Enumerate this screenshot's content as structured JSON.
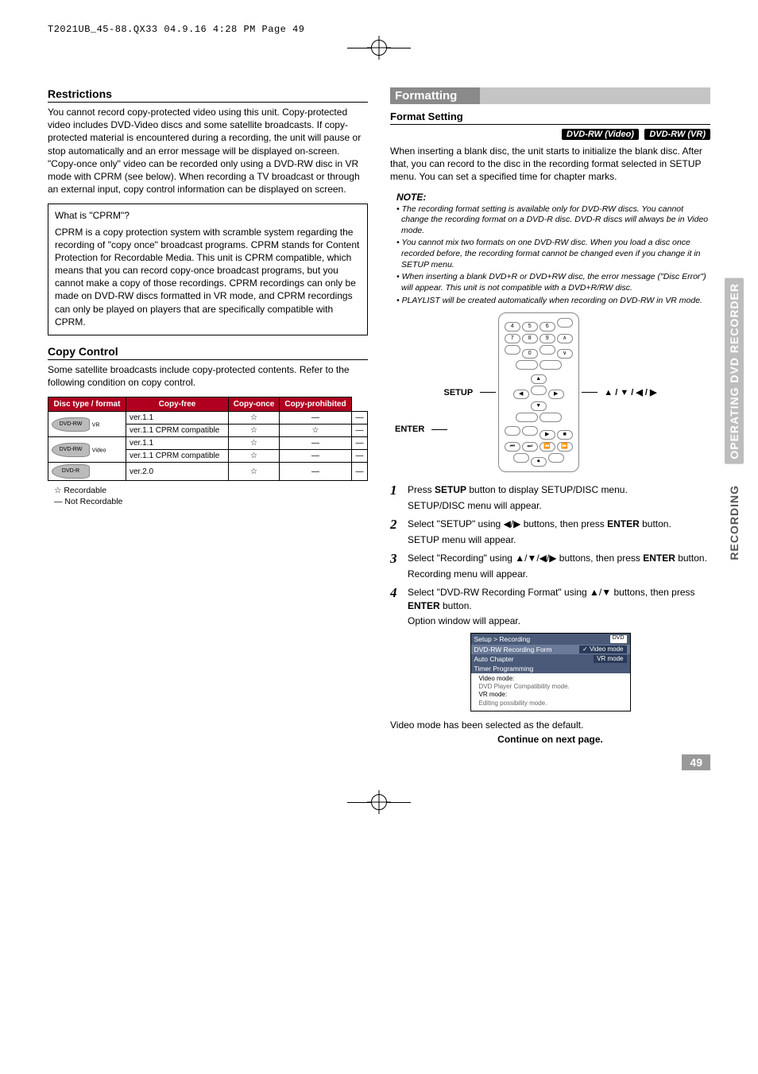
{
  "header": {
    "imprint": "T2021UB_45-88.QX33  04.9.16  4:28 PM  Page 49"
  },
  "side_tabs": {
    "top": "OPERATING DVD RECORDER",
    "bottom": "RECORDING"
  },
  "left": {
    "restrictions": {
      "heading": "Restrictions",
      "body": "You cannot record copy-protected video using this unit. Copy-protected video includes DVD-Video discs and some satellite broadcasts. If copy-protected material is encountered during a recording, the unit will pause or stop automatically and an error message will be displayed on-screen. \"Copy-once only\" video can be recorded only using a DVD-RW disc in VR mode with CPRM (see below). When recording a TV broadcast or through an external input, copy control information can be displayed on screen.",
      "cprm_title": "What is \"CPRM\"?",
      "cprm_body": "CPRM is a copy protection system with scramble system regarding the recording of \"copy once\" broadcast programs. CPRM stands for Content Protection for Recordable Media. This unit is CPRM compatible, which means that you can record copy-once broadcast programs, but you cannot make a copy of those recordings. CPRM recordings can only be made on DVD-RW discs formatted in VR mode, and CPRM recordings can only be played on players that are specifically compatible with CPRM."
    },
    "copy_control": {
      "heading": "Copy Control",
      "body": "Some satellite broadcasts include copy-protected contents. Refer to the following condition on copy control.",
      "table": {
        "headers": [
          "Disc type / format",
          "Copy-free",
          "Copy-once",
          "Copy-prohibited"
        ],
        "rows": [
          {
            "logo": "DVD-RW",
            "sub": "VR",
            "fmt": "ver.1.1",
            "cf": "☆",
            "co": "—",
            "cp": "—"
          },
          {
            "logo": "DVD-RW",
            "sub": "VR",
            "fmt": "ver.1.1 CPRM compatible",
            "cf": "☆",
            "co": "☆",
            "cp": "—"
          },
          {
            "logo": "DVD-RW",
            "sub": "Video",
            "fmt": "ver.1.1",
            "cf": "☆",
            "co": "—",
            "cp": "—"
          },
          {
            "logo": "DVD-RW",
            "sub": "Video",
            "fmt": "ver.1.1 CPRM compatible",
            "cf": "☆",
            "co": "—",
            "cp": "—"
          },
          {
            "logo": "DVD-R",
            "sub": "",
            "fmt": "ver.2.0",
            "cf": "☆",
            "co": "—",
            "cp": "—"
          }
        ]
      },
      "legend_rec": "☆   Recordable",
      "legend_nr": "—   Not Recordable"
    }
  },
  "right": {
    "formatting": {
      "heading": "Formatting",
      "sub": "Format Setting",
      "badges": [
        "DVD-RW (Video)",
        "DVD-RW (VR)"
      ],
      "body": "When inserting a blank disc, the unit starts to initialize the blank disc. After that, you can record to the disc in the recording format selected in SETUP menu. You can set a specified time for chapter marks.",
      "note_title": "NOTE:",
      "notes": [
        "• The recording format setting is available only for DVD-RW discs. You cannot change the recording format on a DVD-R disc. DVD-R discs will always be in Video mode.",
        "• You cannot mix two formats on one DVD-RW disc. When you load a disc once recorded before, the recording format cannot be changed even if you change it in SETUP menu.",
        "• When inserting a blank DVD+R or DVD+RW disc, the error message (\"Disc Error\") will appear. This unit is not compatible with a DVD+R/RW disc.",
        "• PLAYLIST will be created automatically when recording on DVD-RW in VR mode."
      ],
      "remote_labels": {
        "setup": "SETUP",
        "enter": "ENTER",
        "arrows": "▲ / ▼ / ◀ / ▶"
      },
      "steps": [
        {
          "num": "1",
          "text_a": "Press ",
          "bold_a": "SETUP",
          "text_b": " button to display SETUP/DISC menu.",
          "sub": "SETUP/DISC menu will appear."
        },
        {
          "num": "2",
          "text_a": "Select \"SETUP\" using ◀/▶ buttons, then press ",
          "bold_a": "ENTER",
          "text_b": " button.",
          "sub": "SETUP menu will appear."
        },
        {
          "num": "3",
          "text_a": "Select \"Recording\" using ▲/▼/◀/▶ buttons, then press ",
          "bold_a": "ENTER",
          "text_b": " button.",
          "sub": "Recording menu will appear."
        },
        {
          "num": "4",
          "text_a": "Select \"DVD-RW Recording Format\" using ▲/▼ buttons, then press ",
          "bold_a": "ENTER",
          "text_b": " button.",
          "sub": "Option window will appear."
        }
      ],
      "screen": {
        "title": "Setup > Recording",
        "badge": "DVD",
        "rows": [
          {
            "l": "DVD-RW Recording Form",
            "r": "Video mode",
            "check": true,
            "hl": true
          },
          {
            "l": "Auto Chapter",
            "r": "VR mode",
            "check": false,
            "hl": false
          },
          {
            "l": "Timer Programming",
            "r": "",
            "check": false,
            "hl": false
          }
        ],
        "desc": [
          "Video mode:",
          "  DVD Player Compatibility mode.",
          "VR mode:",
          "  Editing possibility mode."
        ]
      },
      "default_note": "Video mode has been selected as the default.",
      "continue": "Continue on next page."
    }
  },
  "page_number": "49"
}
